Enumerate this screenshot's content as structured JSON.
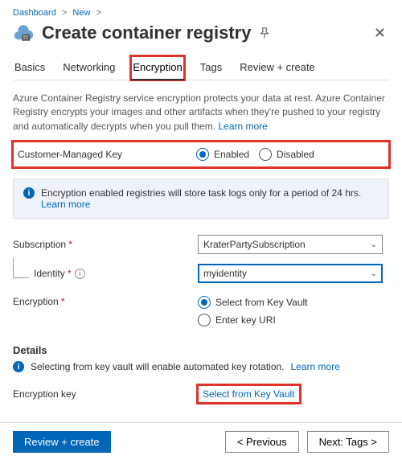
{
  "breadcrumb": {
    "item1": "Dashboard",
    "item2": "New"
  },
  "title": "Create container registry",
  "tabs": {
    "basics": "Basics",
    "networking": "Networking",
    "encryption": "Encryption",
    "tags": "Tags",
    "review": "Review + create"
  },
  "body": {
    "description": "Azure Container Registry service encryption protects your data at rest. Azure Container Registry encrypts your images and other artifacts when they're pushed to your registry and automatically decrypts when you pull them.",
    "learn_more": "Learn more"
  },
  "cmk": {
    "label": "Customer-Managed Key",
    "enabled": "Enabled",
    "disabled": "Disabled"
  },
  "banner": {
    "text": "Encryption enabled registries will store task logs only for a period of 24 hrs.",
    "learn_more": "Learn more"
  },
  "fields": {
    "subscription_label": "Subscription",
    "subscription_value": "KraterPartySubscription",
    "identity_label": "Identity",
    "identity_value": "myidentity",
    "encryption_label": "Encryption",
    "opt_key_vault": "Select from Key Vault",
    "opt_key_uri": "Enter key URI"
  },
  "details": {
    "heading": "Details",
    "info": "Selecting from key vault will enable automated key rotation.",
    "learn_more": "Learn more",
    "enc_key_label": "Encryption key",
    "enc_key_action": "Select from Key Vault"
  },
  "footer": {
    "review": "Review + create",
    "previous": "<  Previous",
    "next": "Next: Tags >"
  }
}
